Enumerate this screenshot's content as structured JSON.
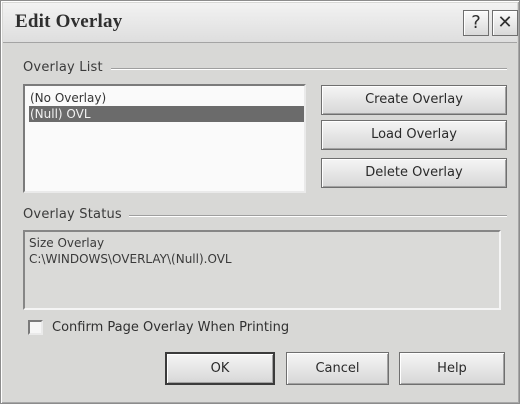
{
  "window": {
    "title": "Edit Overlay",
    "help_glyph": "?",
    "close_glyph": "✕"
  },
  "overlay_list": {
    "label": "Overlay List",
    "items": [
      {
        "label": "(No Overlay)",
        "selected": false
      },
      {
        "label": "(Null) OVL",
        "selected": true
      }
    ]
  },
  "buttons": {
    "create_overlay": "Create Overlay",
    "load_overlay": "Load Overlay",
    "delete_overlay": "Delete Overlay",
    "ok": "OK",
    "cancel": "Cancel",
    "help": "Help"
  },
  "overlay_status": {
    "label": "Overlay Status",
    "lines": [
      "Size Overlay",
      "C:\\WINDOWS\\OVERLAY\\(Null).OVL"
    ]
  },
  "confirm_checkbox": {
    "label": "Confirm Page Overlay When Printing",
    "checked": false
  },
  "colors": {
    "dialog_bg": "#d8d8d6",
    "selection_bg": "#6b6b6b"
  }
}
